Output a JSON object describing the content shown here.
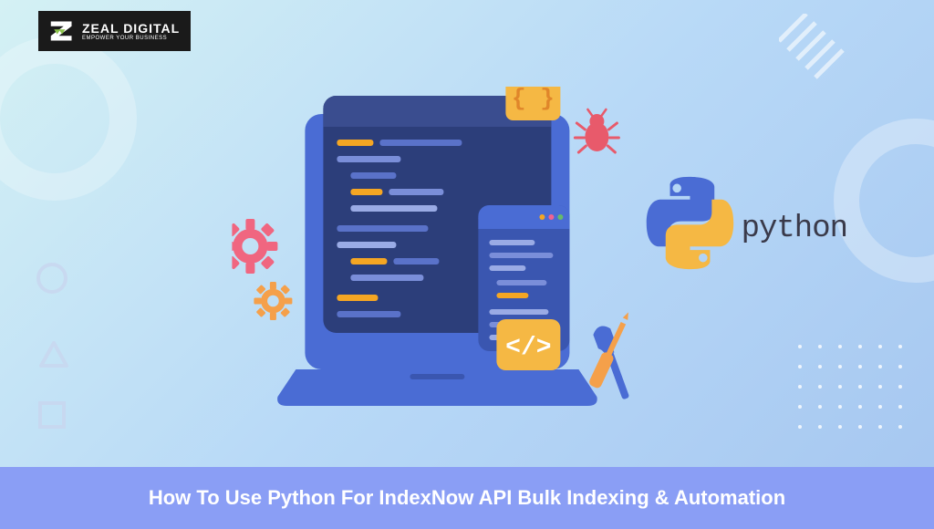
{
  "logo": {
    "main": "ZEAL DIGITAL",
    "sub": "EMPOWER YOUR BUSINESS"
  },
  "python_label": "python",
  "banner": {
    "title": "How To Use Python For IndexNow API Bulk Indexing & Automation"
  },
  "colors": {
    "banner_bg": "#8a9ef5",
    "accent_orange": "#f5a623",
    "accent_pink": "#f06292",
    "laptop_blue": "#4a6cd4",
    "code_bg": "#2c3e7a"
  }
}
